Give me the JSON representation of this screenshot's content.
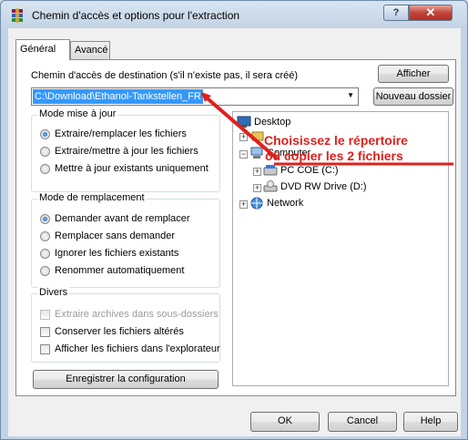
{
  "window": {
    "title": "Chemin d'accès et options pour l'extraction",
    "help_label": "?",
    "close_label": "✕"
  },
  "tabs": [
    {
      "label": "Général",
      "active": true
    },
    {
      "label": "Avancé",
      "active": false
    }
  ],
  "destination": {
    "label": "Chemin d'accès de destination (s'il n'existe pas, il sera créé)",
    "value": "C:\\Download\\Ethanol-Tankstellen_FR",
    "show_button": "Afficher",
    "new_folder_button": "Nouveau dossier"
  },
  "update_mode": {
    "title": "Mode mise à jour",
    "options": [
      {
        "label": "Extraire/remplacer les fichiers",
        "selected": true
      },
      {
        "label": "Extraire/mettre à jour les fichiers",
        "selected": false
      },
      {
        "label": "Mettre à jour existants uniquement",
        "selected": false
      }
    ]
  },
  "replace_mode": {
    "title": "Mode de remplacement",
    "options": [
      {
        "label": "Demander avant de remplacer",
        "selected": true
      },
      {
        "label": "Remplacer sans demander",
        "selected": false
      },
      {
        "label": "Ignorer les fichiers existants",
        "selected": false
      },
      {
        "label": "Renommer automatiquement",
        "selected": false
      }
    ]
  },
  "misc": {
    "title": "Divers",
    "options": [
      {
        "label": "Extraire archives dans sous-dossiers",
        "checked": false,
        "disabled": true
      },
      {
        "label": "Conserver les fichiers altérés",
        "checked": false,
        "disabled": false
      },
      {
        "label": "Afficher les fichiers dans l'explorateur",
        "checked": false,
        "disabled": false
      }
    ]
  },
  "save_config_button": "Enregistrer la configuration",
  "tree": {
    "nodes": [
      {
        "label": "Desktop",
        "icon": "desktop-icon"
      },
      {
        "label": "Computer",
        "icon": "computer-icon"
      },
      {
        "label": "PC COE (C:)",
        "icon": "hard-drive-icon"
      },
      {
        "label": "DVD RW Drive (D:)",
        "icon": "dvd-drive-icon"
      },
      {
        "label": "Network",
        "icon": "network-icon"
      }
    ]
  },
  "annotation": {
    "line1": "Choisissez le répertoire",
    "line2": "où copier les 2 fichiers",
    "color": "#e0201c"
  },
  "footer": {
    "ok": "OK",
    "cancel": "Cancel",
    "help": "Help"
  }
}
